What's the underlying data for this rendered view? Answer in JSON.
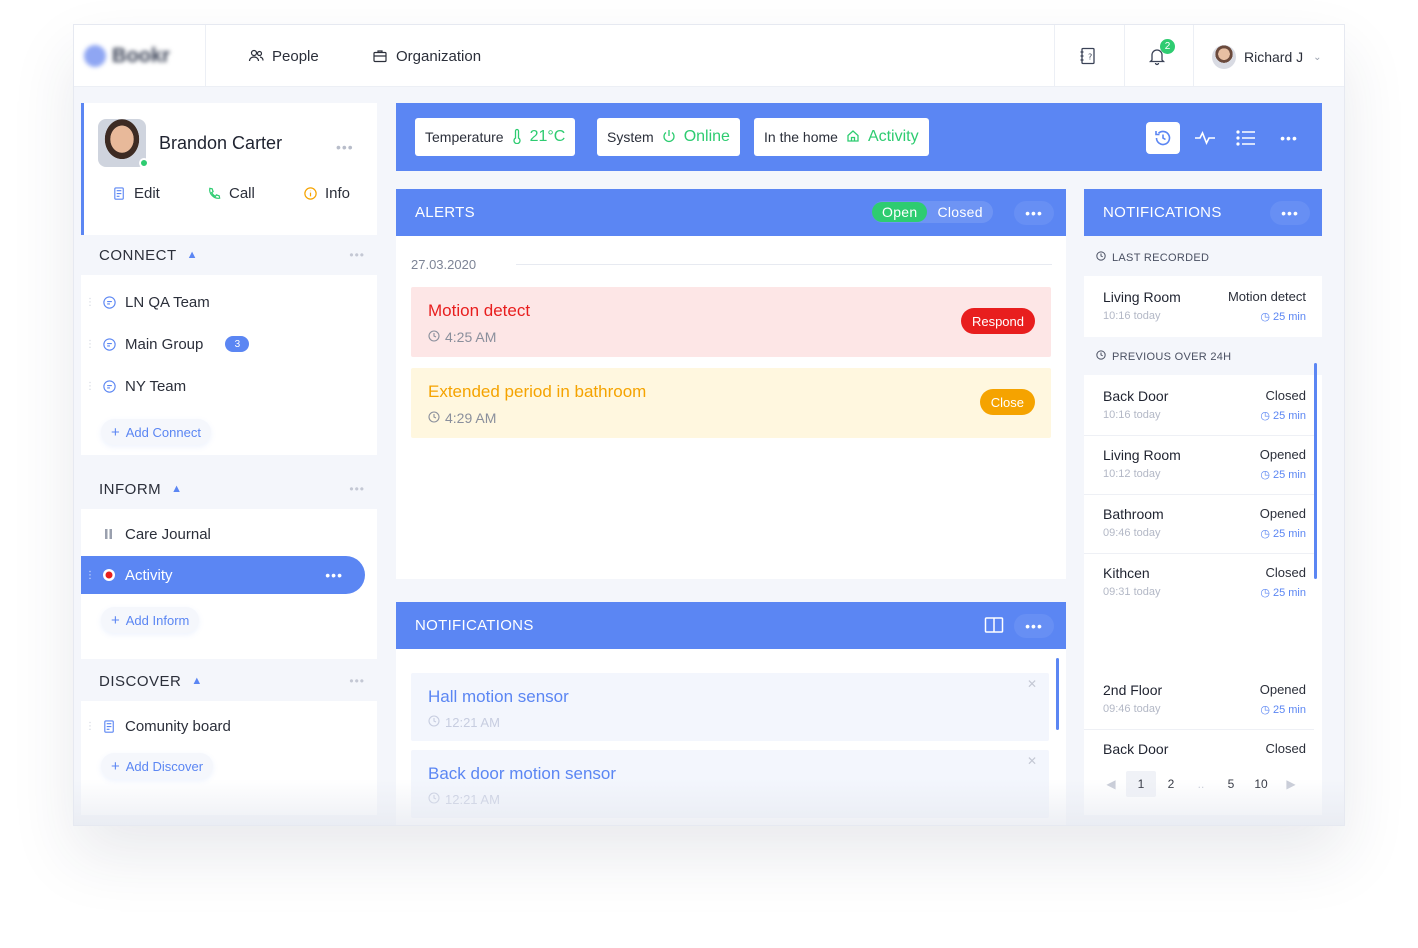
{
  "topbar": {
    "logo_text": "Bookr",
    "nav": [
      {
        "label": "People",
        "icon": "people-icon"
      },
      {
        "label": "Organization",
        "icon": "briefcase-icon"
      }
    ],
    "notification_count": "2",
    "user_name": "Richard J"
  },
  "profile": {
    "name": "Brandon Carter",
    "actions": [
      {
        "label": "Edit",
        "icon": "edit-icon"
      },
      {
        "label": "Call",
        "icon": "phone-icon"
      },
      {
        "label": "Info",
        "icon": "info-icon"
      }
    ]
  },
  "sidebar": {
    "connect": {
      "title": "CONNECT",
      "items": [
        {
          "label": "LN QA Team"
        },
        {
          "label": "Main Group",
          "badge": "3"
        },
        {
          "label": "NY Team"
        }
      ],
      "add_label": "Add Connect"
    },
    "inform": {
      "title": "INFORM",
      "items": [
        {
          "label": "Care Journal"
        },
        {
          "label": "Activity"
        }
      ],
      "add_label": "Add Inform"
    },
    "discover": {
      "title": "DISCOVER",
      "items": [
        {
          "label": "Comunity board"
        }
      ],
      "add_label": "Add Discover"
    }
  },
  "statusbar": {
    "temperature": {
      "label": "Temperature",
      "value": "21°C"
    },
    "system": {
      "label": "System",
      "value": "Online"
    },
    "home": {
      "label": "In the home",
      "value": "Activity"
    }
  },
  "alerts": {
    "title": "ALERTS",
    "toggle_open": "Open",
    "toggle_closed": "Closed",
    "date": "27.03.2020",
    "items": [
      {
        "title": "Motion detect",
        "time": "4:25 AM",
        "button": "Respond",
        "color": "#e81e1e",
        "bg": "#fde6e6"
      },
      {
        "title": "Extended period in bathroom",
        "time": "4:29 AM",
        "button": "Close",
        "color": "#f5a300",
        "bg": "#fff7df"
      }
    ]
  },
  "notifications_panel": {
    "title": "NOTIFICATIONS",
    "items": [
      {
        "title": "Hall motion sensor",
        "time": "12:21 AM"
      },
      {
        "title": "Back door motion sensor",
        "time": "12:21 AM"
      }
    ]
  },
  "right_notifications": {
    "title": "NOTIFICATIONS",
    "last_recorded_label": "LAST RECORDED",
    "last_recorded": {
      "name": "Living Room",
      "status": "Motion detect",
      "date": "10:16 today",
      "ago": "25 min"
    },
    "previous_label": "PREVIOUS OVER 24H",
    "previous": [
      {
        "name": "Back Door",
        "status": "Closed",
        "date": "10:16 today",
        "ago": "25 min"
      },
      {
        "name": "Living Room",
        "status": "Opened",
        "date": "10:12 today",
        "ago": "25 min"
      },
      {
        "name": "Bathroom",
        "status": "Opened",
        "date": "09:46 today",
        "ago": "25 min"
      },
      {
        "name": "Kithcen",
        "status": "Closed",
        "date": "09:31 today",
        "ago": "25 min"
      },
      {
        "name": "2nd Floor",
        "status": "Opened",
        "date": "09:46 today",
        "ago": "25 min"
      },
      {
        "name": "Back Door",
        "status": "Closed",
        "date": "",
        "ago": ""
      }
    ],
    "pager": [
      "1",
      "2",
      "..",
      "5",
      "10"
    ]
  },
  "colors": {
    "accent": "#5b86f3",
    "success": "#2ecc71",
    "danger": "#e81e1e",
    "warning": "#f5a300"
  }
}
